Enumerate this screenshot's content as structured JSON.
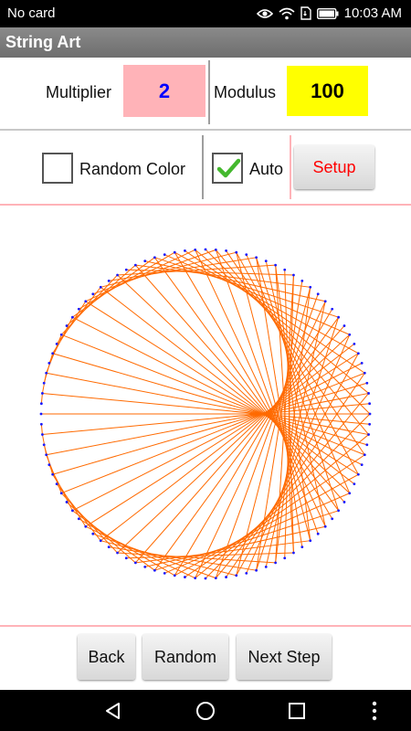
{
  "status": {
    "carrier": "No card",
    "time": "10:03 AM"
  },
  "app": {
    "title": "String Art"
  },
  "params": {
    "multiplier_label": "Multiplier",
    "multiplier_value": "2",
    "modulus_label": "Modulus",
    "modulus_value": "100"
  },
  "options": {
    "random_color_label": "Random Color",
    "random_color_checked": false,
    "auto_label": "Auto",
    "auto_checked": true,
    "setup_label": "Setup"
  },
  "art": {
    "multiplier": 2,
    "modulus": 100,
    "line_color": "#ff6a00",
    "point_color": "#1a1aff"
  },
  "buttons": {
    "back": "Back",
    "random": "Random",
    "next_step": "Next Step"
  },
  "colors": {
    "multiplier_bg": "#ffb3b8",
    "modulus_bg": "#ffff00",
    "separator": "#ffb3b8",
    "setup_text": "#ff0000"
  }
}
